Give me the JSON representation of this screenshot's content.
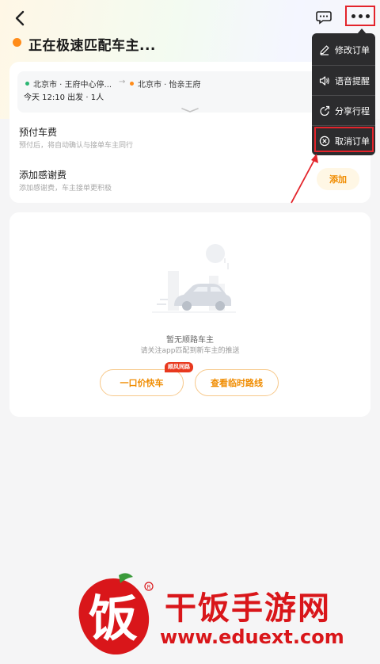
{
  "header": {
    "status_title": "正在极速匹配车主..."
  },
  "route": {
    "from": "北京市 · 王府中心停...",
    "to": "北京市 · 怡亲王府",
    "trip_info": "今天 12:10 出发 · 1人"
  },
  "prepay": {
    "title": "预付车费",
    "subtitle": "预付后，将自动确认与接单车主同行"
  },
  "thanks_fee": {
    "title": "添加感谢费",
    "subtitle": "添加感谢费，车主接单更积极",
    "button": "添加"
  },
  "empty_state": {
    "title": "暂无顺路车主",
    "subtitle": "请关注app匹配到新车主的推送",
    "option_a": "一口价快车",
    "option_a_badge": "顺风同路",
    "option_b": "查看临时路线"
  },
  "menu": {
    "items": [
      {
        "label": "修改订单",
        "icon": "pencil-icon"
      },
      {
        "label": "语音提醒",
        "icon": "speaker-icon"
      },
      {
        "label": "分享行程",
        "icon": "share-icon"
      },
      {
        "label": "取消订单",
        "icon": "cancel-circle-icon"
      }
    ]
  },
  "watermark": {
    "title": "干饭手游网",
    "url": "www.eduext.com",
    "logo_glyph": "饭"
  },
  "colors": {
    "accent_orange": "#f08c00",
    "highlight_red": "#e3242b",
    "menu_bg": "#2c2c2e",
    "origin_dot": "#2bb673",
    "dest_dot": "#ff8c1a"
  }
}
